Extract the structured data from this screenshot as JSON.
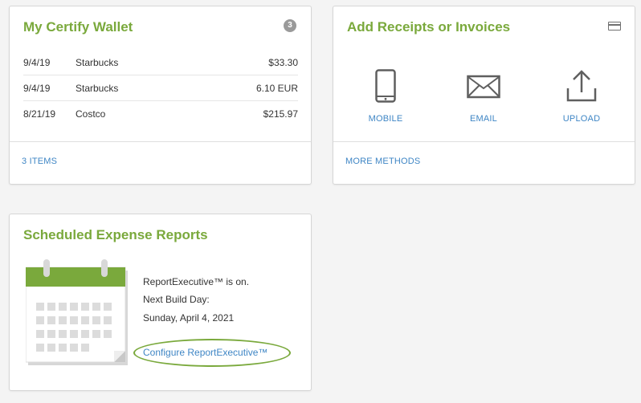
{
  "wallet": {
    "title": "My Certify Wallet",
    "badge_count": "3",
    "rows": [
      {
        "date": "9/4/19",
        "merchant": "Starbucks",
        "amount": "$33.30"
      },
      {
        "date": "9/4/19",
        "merchant": "Starbucks",
        "amount": "6.10 EUR"
      },
      {
        "date": "8/21/19",
        "merchant": "Costco",
        "amount": "$215.97"
      }
    ],
    "footer_link": "3 ITEMS"
  },
  "receipts": {
    "title": "Add Receipts or Invoices",
    "header_icon": "credit-card-icon",
    "methods": [
      {
        "label": "MOBILE",
        "icon": "mobile-phone-icon"
      },
      {
        "label": "EMAIL",
        "icon": "envelope-icon"
      },
      {
        "label": "UPLOAD",
        "icon": "upload-icon"
      }
    ],
    "footer_link": "MORE METHODS"
  },
  "scheduled": {
    "title": "Scheduled Expense Reports",
    "illustration": "calendar-icon",
    "status_text": "ReportExecutive™ is on.",
    "next_build_label": "Next Build Day:",
    "next_build_date": "Sunday, April 4, 2021",
    "configure_link": "Configure ReportExecutive™"
  },
  "colors": {
    "accent_green": "#7aa93c",
    "link_blue": "#3f86c5",
    "icon_gray": "#5f5f5f",
    "page_background": "#f4f4f4"
  }
}
